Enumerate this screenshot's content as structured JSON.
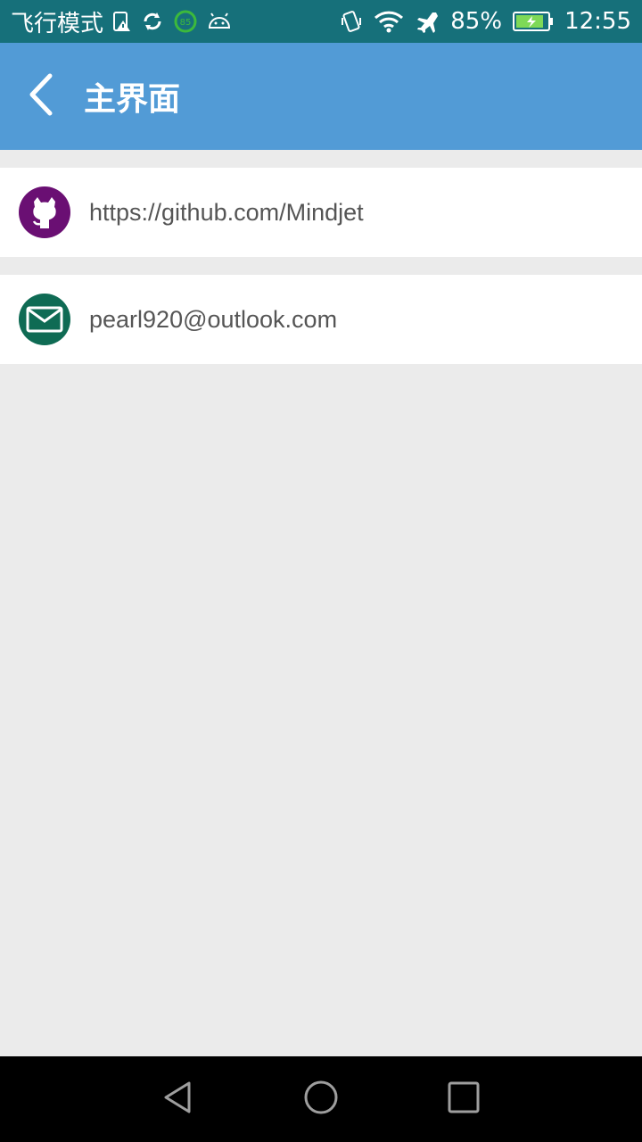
{
  "status_bar": {
    "mode_label": "飞行模式",
    "battery_percent": "85%",
    "time": "12:55",
    "icons_left": [
      "sim-warning-icon",
      "sync-icon",
      "battery-85-icon",
      "android-icon"
    ],
    "icons_right": [
      "vibrate-icon",
      "wifi-icon",
      "airplane-icon",
      "battery-charging-icon"
    ],
    "color": "#16707a"
  },
  "app_bar": {
    "title": "主界面",
    "back_icon": "chevron-left-icon",
    "color": "#529bd6"
  },
  "list": {
    "items": [
      {
        "icon": "github-icon",
        "text": "https://github.com/Mindjet",
        "icon_color": "#6a0f73"
      },
      {
        "icon": "mail-icon",
        "text": "pearl920@outlook.com",
        "icon_color": "#0f6b54"
      }
    ]
  },
  "nav_bar": {
    "buttons": [
      "back-triangle-icon",
      "home-circle-icon",
      "recents-square-icon"
    ]
  }
}
